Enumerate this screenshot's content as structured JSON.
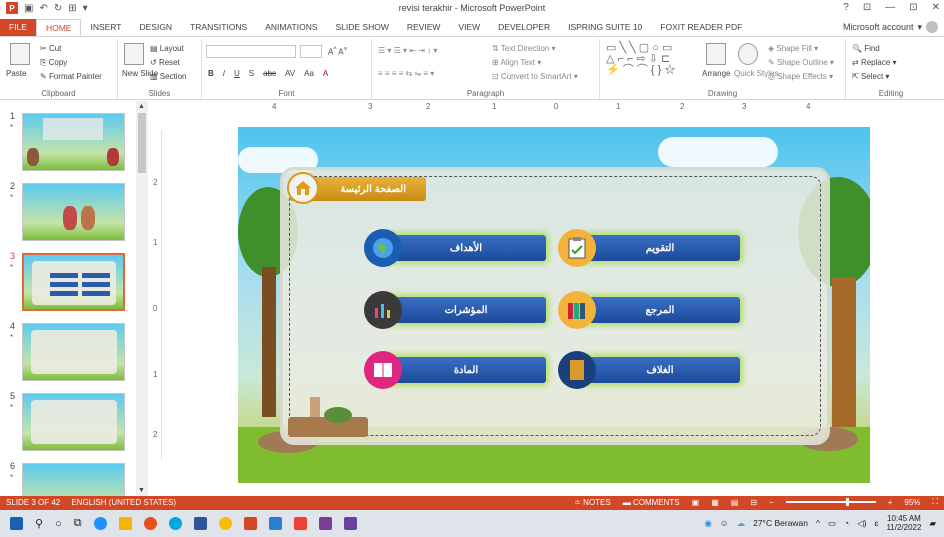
{
  "window": {
    "title": "revisi terakhir - Microsoft PowerPoint",
    "controls": [
      "?",
      "⊡",
      "—",
      "⊡",
      "✕"
    ],
    "account": "Microsoft account"
  },
  "tabs": [
    "FILE",
    "HOME",
    "INSERT",
    "DESIGN",
    "TRANSITIONS",
    "ANIMATIONS",
    "SLIDE SHOW",
    "REVIEW",
    "VIEW",
    "DEVELOPER",
    "ISPRING SUITE 10",
    "FOXIT READER PDF"
  ],
  "ribbon": {
    "clipboard": {
      "label": "Clipboard",
      "paste": "Paste",
      "cut": "Cut",
      "copy": "Copy",
      "format_painter": "Format Painter"
    },
    "slides": {
      "label": "Slides",
      "new_slide": "New Slide",
      "layout": "Layout",
      "reset": "Reset",
      "section": "Section"
    },
    "font": {
      "label": "Font",
      "bold": "B",
      "italic": "I",
      "underline": "U",
      "shadow": "S",
      "strike": "abc",
      "spacing": "AV",
      "case": "Aa",
      "color": "A"
    },
    "paragraph": {
      "label": "Paragraph",
      "text_direction": "Text Direction",
      "align_text": "Align Text",
      "convert": "Convert to SmartArt"
    },
    "drawing": {
      "label": "Drawing",
      "arrange": "Arrange",
      "quick_styles": "Quick Styles",
      "shape_fill": "Shape Fill",
      "shape_outline": "Shape Outline",
      "shape_effects": "Shape Effects"
    },
    "editing": {
      "label": "Editing",
      "find": "Find",
      "replace": "Replace",
      "select": "Select"
    }
  },
  "thumbnails": [
    {
      "num": "1",
      "star": "*"
    },
    {
      "num": "2",
      "star": "*"
    },
    {
      "num": "3",
      "star": "*"
    },
    {
      "num": "4",
      "star": "*"
    },
    {
      "num": "5",
      "star": "*"
    },
    {
      "num": "6",
      "star": "*"
    }
  ],
  "ruler": {
    "h": [
      "4",
      "3",
      "2",
      "1",
      "0",
      "1",
      "2",
      "3",
      "4"
    ],
    "v": [
      "2",
      "1",
      "0",
      "1",
      "2"
    ]
  },
  "slide": {
    "home_title": "الصفحة الرئيسة",
    "buttons": [
      {
        "label": "الأهداف",
        "icon": "globe-icon"
      },
      {
        "label": "التقويم",
        "icon": "clipboard-icon"
      },
      {
        "label": "المؤشرات",
        "icon": "chart-icon"
      },
      {
        "label": "المرجع",
        "icon": "books-icon"
      },
      {
        "label": "المادة",
        "icon": "book-icon"
      },
      {
        "label": "الغلاف",
        "icon": "cover-icon"
      }
    ]
  },
  "status": {
    "slide_info": "SLIDE 3 OF 42",
    "language": "ENGLISH (UNITED STATES)",
    "notes": "NOTES",
    "comments": "COMMENTS",
    "zoom": "95%"
  },
  "taskbar": {
    "weather": "27°C Berawan",
    "time": "10:45 AM",
    "date": "11/2/2022"
  }
}
